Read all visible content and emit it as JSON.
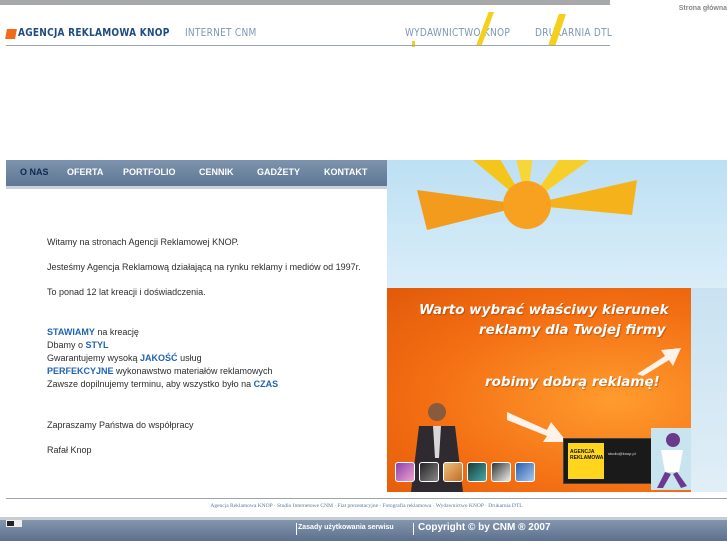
{
  "header": {
    "home_link": "Strona główna",
    "brands": [
      "AGENCJA REKLAMOWA KNOP",
      "INTERNET CNM",
      "WYDAWNICTWO KNOP",
      "DRUKARNIA DTL"
    ]
  },
  "menu": {
    "items": [
      "O NAS",
      "OFERTA",
      "PORTFOLIO",
      "CENNIK",
      "GADŻETY",
      "KONTAKT"
    ],
    "active_index": 0
  },
  "content": {
    "p1": "Witamy na stronach Agencji Reklamowej KNOP.",
    "p2": "Jesteśmy Agencja Reklamową działającą na rynku reklamy i mediów od 1997r.",
    "p3": "To ponad 12 lat kreacji i doświadczenia.",
    "l1_hl": "STAWIAMY",
    "l1_rest": " na kreację",
    "l2_pre": "Dbamy o ",
    "l2_hl": "STYL",
    "l3_pre": "Gwarantujemy wysoką ",
    "l3_hl": "JAKOŚĆ",
    "l3_rest": " usług",
    "l4_hl": "PERFEKCYJNE",
    "l4_rest": " wykonawstwo materiałów reklamowych",
    "l5_pre": "Zawsze dopilnujemy terminu, aby wszystko było na ",
    "l5_hl": "CZAS",
    "p5": "Zapraszamy Państwa do współpracy",
    "signature": "Rafał Knop"
  },
  "banner": {
    "line1": "Warto wybrać właściwy kierunek",
    "line2": "reklamy dla Twojej firmy",
    "line3": "robimy dobrą reklamę!",
    "logo_label_1": "AGENCJA",
    "logo_label_2": "REKLAMOWA",
    "logo_info": "studio@knop.pl"
  },
  "footer": {
    "links_text": "Agencja Reklamowa KNOP · Studio Internetowe CNM · Fiat prezentacyjne · Fotografia reklamowa · Wydawnictwo KNOP · Drukarnia DTL",
    "terms": "Zasady użytkowania serwisu",
    "copyright": "Copyright © by CNM ® 2007"
  },
  "colors": {
    "brand_blue": "#1e4b85",
    "accent_orange": "#f26b1d",
    "highlight_blue": "#1f63b5",
    "menu_bar": "#6a819d"
  }
}
